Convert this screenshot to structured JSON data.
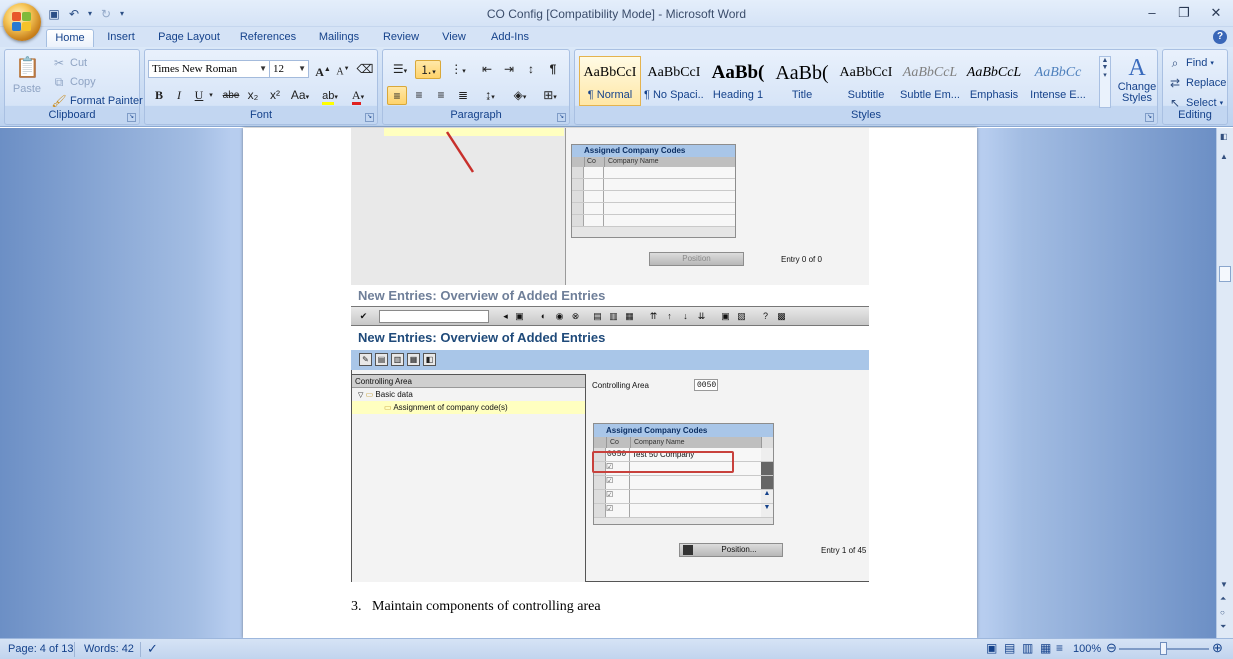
{
  "window": {
    "title": "CO Config [Compatibility Mode] - Microsoft Word",
    "minimize": "–",
    "maximize": "❐",
    "close": "✕"
  },
  "tabs": [
    "Home",
    "Insert",
    "Page Layout",
    "References",
    "Mailings",
    "Review",
    "View",
    "Add-Ins"
  ],
  "ribbon": {
    "clipboard": {
      "label": "Clipboard",
      "paste": "Paste",
      "cut": "Cut",
      "copy": "Copy",
      "format_painter": "Format Painter"
    },
    "font": {
      "label": "Font",
      "font_name": "Times New Roman",
      "font_size": "12",
      "bold": "B",
      "italic": "I",
      "underline": "U",
      "strikethrough": "abe",
      "subscript": "x₂",
      "superscript": "x²",
      "change_case": "Aa",
      "grow": "A",
      "shrink": "A"
    },
    "paragraph": {
      "label": "Paragraph"
    },
    "styles": {
      "label": "Styles",
      "items": [
        {
          "sample": "AaBbCcI",
          "name": "¶ Normal"
        },
        {
          "sample": "AaBbCcI",
          "name": "¶ No Spaci..."
        },
        {
          "sample": "AaBb(",
          "name": "Heading 1"
        },
        {
          "sample": "AaBb(",
          "name": "Title"
        },
        {
          "sample": "AaBbCcI",
          "name": "Subtitle"
        },
        {
          "sample": "AaBbCcL",
          "name": "Subtle Em..."
        },
        {
          "sample": "AaBbCcL",
          "name": "Emphasis"
        },
        {
          "sample": "AaBbCc",
          "name": "Intense E..."
        }
      ],
      "change_styles": "Change Styles"
    },
    "editing": {
      "label": "Editing",
      "find": "Find",
      "replace": "Replace",
      "select": "Select"
    }
  },
  "document": {
    "sap_top": {
      "assigned_header": "Assigned Company Codes",
      "col_co": "Co",
      "col_name": "Company Name",
      "position_btn": "Position",
      "entry": "Entry 0 of 0"
    },
    "sap_title_faded": "New Entries: Overview of Added Entries",
    "sap_title": "New Entries: Overview of Added Entries",
    "tree": {
      "header": "Controlling Area",
      "items": [
        "Basic data",
        "Assignment of company code(s)"
      ]
    },
    "controlling_area_label": "Controlling Area",
    "controlling_area_value": "0050",
    "assigned": {
      "header": "Assigned Company Codes",
      "col_co": "Co",
      "col_name": "Company Name",
      "row_code": "0050",
      "row_name": "Test 50 Company"
    },
    "position_btn": "Position...",
    "entry": "Entry 1 of 45",
    "step_number": "3.",
    "step_text": "Maintain components of controlling area"
  },
  "status": {
    "page": "Page: 4 of 13",
    "words": "Words: 42",
    "zoom": "100%"
  }
}
